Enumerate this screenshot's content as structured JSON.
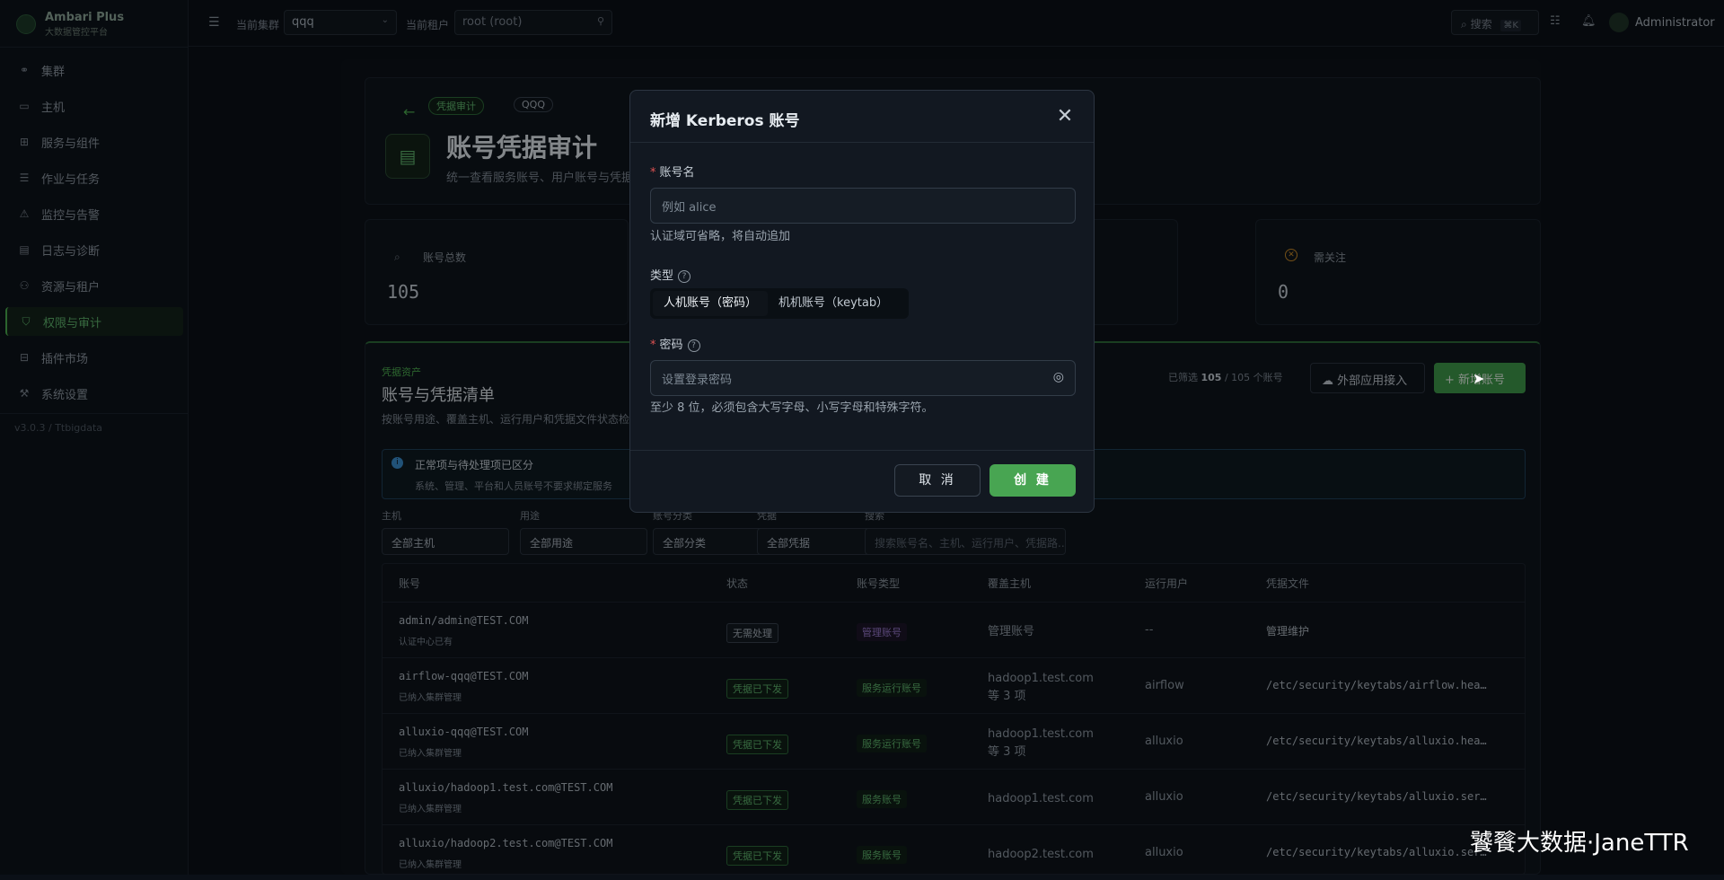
{
  "app": {
    "name": "Ambari Plus",
    "subtitle": "大数据管控平台",
    "version": "v3.0.3 / Ttbigdata"
  },
  "sidebar": {
    "items": [
      {
        "label": "集群",
        "icon": "link-icon"
      },
      {
        "label": "主机",
        "icon": "monitor-icon"
      },
      {
        "label": "服务与组件",
        "icon": "grid-icon"
      },
      {
        "label": "作业与任务",
        "icon": "list-icon"
      },
      {
        "label": "监控与告警",
        "icon": "alarm-icon"
      },
      {
        "label": "日志与诊断",
        "icon": "file-icon"
      },
      {
        "label": "资源与租户",
        "icon": "users-icon"
      },
      {
        "label": "权限与审计",
        "icon": "shield-icon"
      },
      {
        "label": "插件市场",
        "icon": "plugin-icon"
      },
      {
        "label": "系统设置",
        "icon": "wrench-icon"
      }
    ]
  },
  "topbar": {
    "cluster_label": "当前集群",
    "cluster_value": "qqq",
    "tenant_label": "当前租户",
    "tenant_value": "root (root)",
    "search_label": "搜索",
    "search_shortcut": "⌘K",
    "user": "Administrator"
  },
  "page": {
    "tag1": "凭据审计",
    "tag2": "QQQ",
    "title": "账号凭据审计",
    "desc": "统一查看服务账号、用户账号与凭据"
  },
  "stats": [
    {
      "label": "账号总数",
      "value": "105"
    },
    {
      "label": "需关注",
      "value": "0"
    }
  ],
  "list": {
    "eyebrow": "凭据资产",
    "title": "账号与凭据清单",
    "desc": "按账号用途、覆盖主机、运行用户和凭据文件状态检",
    "filtered_prefix": "已筛选",
    "filtered_count": "105",
    "filtered_suffix": "/ 105 个账号",
    "external_btn": "外部应用接入",
    "add_btn": "新增账号",
    "notice_title": "正常项与待处理项已区分",
    "notice_desc": "系统、管理、平台和人员账号不要求绑定服务",
    "filters": [
      {
        "label": "主机",
        "value": "全部主机"
      },
      {
        "label": "用途",
        "value": "全部用途"
      },
      {
        "label": "账号分类",
        "value": "全部分类"
      },
      {
        "label": "凭据",
        "value": "全部凭据"
      },
      {
        "label": "搜索",
        "value": "搜索账号名、主机、运行用户、凭据路..."
      }
    ],
    "columns": [
      "账号",
      "状态",
      "账号类型",
      "覆盖主机",
      "运行用户",
      "凭据文件"
    ],
    "rows": [
      {
        "account": "admin/admin@TEST.COM",
        "note": "认证中心已有",
        "status": "无需处理",
        "type": "管理账号",
        "hosts": "管理账号",
        "user": "--",
        "file": "管理维护"
      },
      {
        "account": "airflow-qqq@TEST.COM",
        "note": "已纳入集群管理",
        "status": "凭据已下发",
        "type": "服务运行账号",
        "hosts": "hadoop1.test.com 等 3 项",
        "user": "airflow",
        "file": "/etc/security/keytabs/airflow.hea…"
      },
      {
        "account": "alluxio-qqq@TEST.COM",
        "note": "已纳入集群管理",
        "status": "凭据已下发",
        "type": "服务运行账号",
        "hosts": "hadoop1.test.com 等 3 项",
        "user": "alluxio",
        "file": "/etc/security/keytabs/alluxio.hea…"
      },
      {
        "account": "alluxio/hadoop1.test.com@TEST.COM",
        "note": "已纳入集群管理",
        "status": "凭据已下发",
        "type": "服务账号",
        "hosts": "hadoop1.test.com",
        "user": "alluxio",
        "file": "/etc/security/keytabs/alluxio.ser…"
      },
      {
        "account": "alluxio/hadoop2.test.com@TEST.COM",
        "note": "已纳入集群管理",
        "status": "凭据已下发",
        "type": "服务账号",
        "hosts": "hadoop2.test.com",
        "user": "alluxio",
        "file": "/etc/security/keytabs/alluxio.ser…"
      }
    ]
  },
  "modal": {
    "title": "新增 Kerberos 账号",
    "account_label": "账号名",
    "account_placeholder": "例如 alice",
    "account_hint": "认证域可省略，将自动追加",
    "type_label": "类型",
    "type_options": [
      "人机账号（密码）",
      "机机账号（keytab）"
    ],
    "password_label": "密码",
    "password_placeholder": "设置登录密码",
    "password_hint": "至少 8 位，必须包含大写字母、小写字母和特殊字符。",
    "cancel": "取 消",
    "create": "创 建"
  },
  "watermark": "饕餮大数据·JaneTTR"
}
